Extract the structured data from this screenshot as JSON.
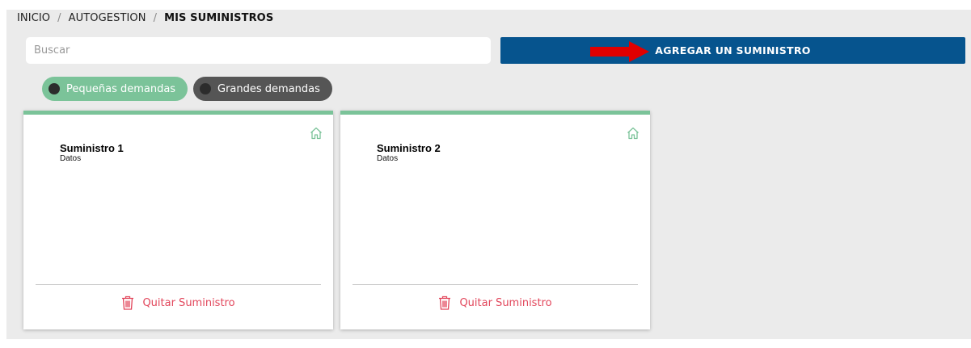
{
  "breadcrumb": {
    "items": [
      "INICIO",
      "AUTOGESTION"
    ],
    "separator": "/",
    "current": "MIS SUMINISTROS"
  },
  "search": {
    "placeholder": "Buscar",
    "value": ""
  },
  "add_button": {
    "label": "AGREGAR UN SUMINISTRO"
  },
  "filters": [
    {
      "label": "Pequeñas demandas",
      "active": true
    },
    {
      "label": "Grandes demandas",
      "active": false
    }
  ],
  "cards": [
    {
      "title": "Suministro 1",
      "subtitle": "Datos",
      "remove_label": "Quitar Suministro",
      "icon": "home-icon"
    },
    {
      "title": "Suministro 2",
      "subtitle": "Datos",
      "remove_label": "Quitar Suministro",
      "icon": "home-icon"
    }
  ],
  "colors": {
    "primary": "#06548e",
    "accent_green": "#7bc399",
    "danger": "#e2465b",
    "dark_toggle": "#555555",
    "annotation_arrow": "#e00000"
  }
}
